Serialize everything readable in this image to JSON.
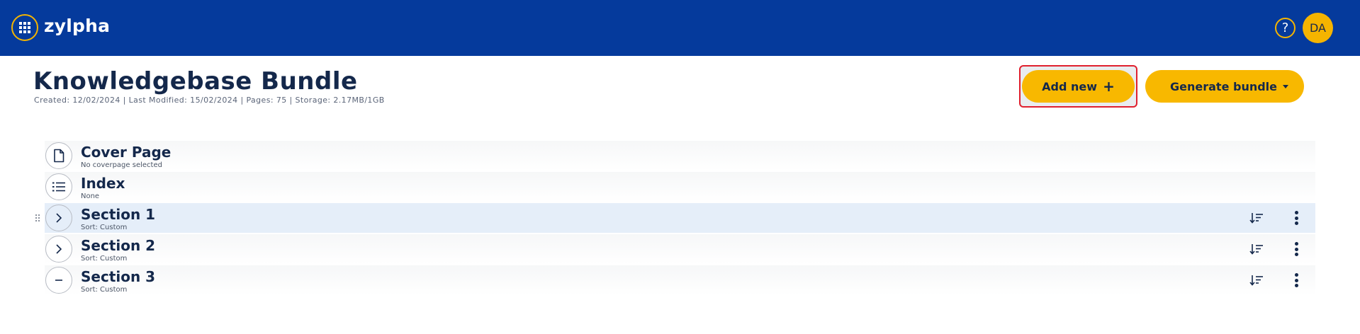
{
  "app": {
    "brand": "zylpha",
    "user_initials": "DA",
    "help_symbol": "?",
    "colors": {
      "topbar": "#053a9c",
      "accent": "#f8b800",
      "highlight_border": "#e0202e"
    }
  },
  "header": {
    "title": "Knowledgebase Bundle",
    "meta": "Created: 12/02/2024 | Last Modified: 15/02/2024 | Pages: 75 | Storage: 2.17MB/1GB",
    "add_new_label": "Add new",
    "add_new_icon": "plus-icon",
    "generate_label": "Generate bundle",
    "generate_icon": "caret-down-icon"
  },
  "items": [
    {
      "name": "Cover Page",
      "sub": "No coverpage selected",
      "icon": "document-icon"
    },
    {
      "name": "Index",
      "sub": "None",
      "icon": "numbered-list-icon"
    },
    {
      "name": "Section 1",
      "sub": "Sort: Custom",
      "icon": "chevron-right-icon"
    },
    {
      "name": "Section 2",
      "sub": "Sort: Custom",
      "icon": "chevron-right-icon"
    },
    {
      "name": "Section 3",
      "sub": "Sort: Custom",
      "icon": "minus-icon"
    }
  ]
}
